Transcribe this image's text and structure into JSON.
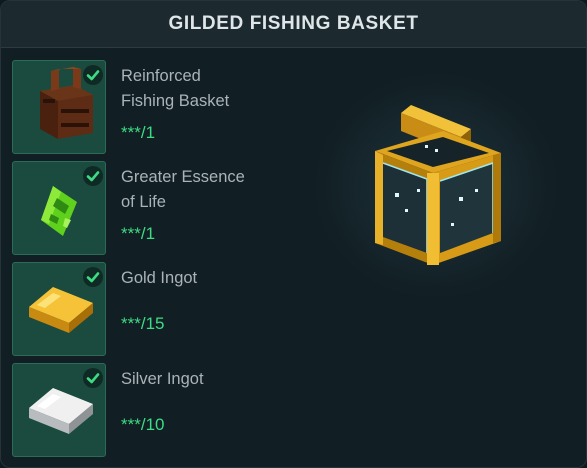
{
  "title": "GILDED FISHING BASKET",
  "colors": {
    "slot_bg": "#1b4b3e",
    "quantity": "#3ddc84",
    "check": "#3ddc84",
    "gold": "#d9a321"
  },
  "preview": {
    "icon": "gilded-fishing-basket-icon"
  },
  "ingredients": [
    {
      "name": "Reinforced\nFishing Basket",
      "quantity": "***/1",
      "icon": "reinforced-fishing-basket-icon",
      "completed": true
    },
    {
      "name": "Greater Essence\nof Life",
      "quantity": "***/1",
      "icon": "greater-essence-of-life-icon",
      "completed": true
    },
    {
      "name": "Gold Ingot",
      "quantity": "***/15",
      "icon": "gold-ingot-icon",
      "completed": true
    },
    {
      "name": "Silver Ingot",
      "quantity": "***/10",
      "icon": "silver-ingot-icon",
      "completed": true
    }
  ]
}
